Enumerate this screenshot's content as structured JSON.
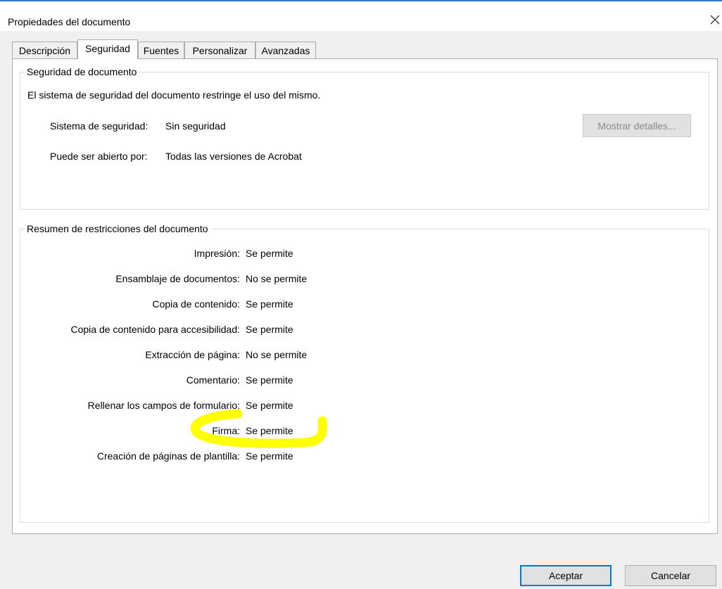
{
  "window": {
    "title": "Propiedades del documento",
    "close_icon": "close-icon"
  },
  "tabs": [
    {
      "label": "Descripción",
      "active": false
    },
    {
      "label": "Seguridad",
      "active": true
    },
    {
      "label": "Fuentes",
      "active": false
    },
    {
      "label": "Personalizar",
      "active": false
    },
    {
      "label": "Avanzadas",
      "active": false
    }
  ],
  "security": {
    "group_title": "Seguridad de documento",
    "description": "El sistema de seguridad del documento restringe el uso del mismo.",
    "system_label": "Sistema de seguridad:",
    "system_value": "Sin seguridad",
    "opened_by_label": "Puede ser abierto por:",
    "opened_by_value": "Todas las versiones de Acrobat",
    "details_button": "Mostrar detalles..."
  },
  "restrictions": {
    "group_title": "Resumen de restricciones del documento",
    "items": [
      {
        "label": "Impresión:",
        "value": "Se permite"
      },
      {
        "label": "Ensamblaje de documentos:",
        "value": "No se permite"
      },
      {
        "label": "Copia de contenido:",
        "value": "Se permite"
      },
      {
        "label": "Copia de contenido para accesibilidad:",
        "value": "Se permite"
      },
      {
        "label": "Extracción de página:",
        "value": "No se permite"
      },
      {
        "label": "Comentario:",
        "value": "Se permite"
      },
      {
        "label": "Rellenar los campos de formulario:",
        "value": "Se permite"
      },
      {
        "label": "Firma:",
        "value": "Se permite"
      },
      {
        "label": "Creación de páginas de plantilla:",
        "value": "Se permite"
      }
    ]
  },
  "footer": {
    "ok_label": "Aceptar",
    "cancel_label": "Cancelar"
  },
  "colors": {
    "highlight": "#ffff00",
    "accent": "#0078d7"
  }
}
